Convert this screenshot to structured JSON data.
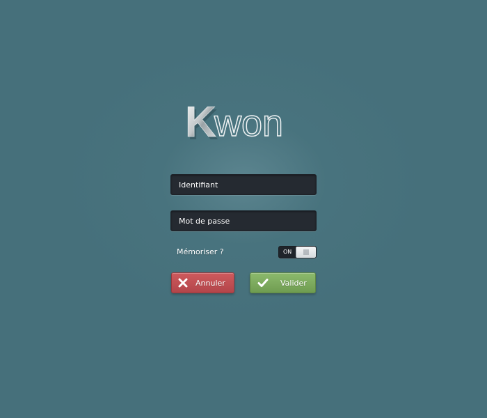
{
  "logo": {
    "text": "Kwon",
    "initial": "K",
    "rest": "won"
  },
  "form": {
    "username_placeholder": "Identifiant",
    "password_placeholder": "Mot de passe",
    "remember_label": "Mémoriser  ?",
    "remember_toggle_state": "ON",
    "cancel_label": "Annuler",
    "validate_label": "Valider"
  },
  "icons": {
    "logo": "kwon-logo",
    "cancel": "close-icon",
    "validate": "checkmark-icon",
    "toggle_grip": "grip-icon"
  },
  "colors": {
    "background": "#46707b",
    "field_background": "#252a31",
    "cancel_button": "#c04f53",
    "validate_button": "#7eab5e",
    "text": "#ffffff"
  }
}
